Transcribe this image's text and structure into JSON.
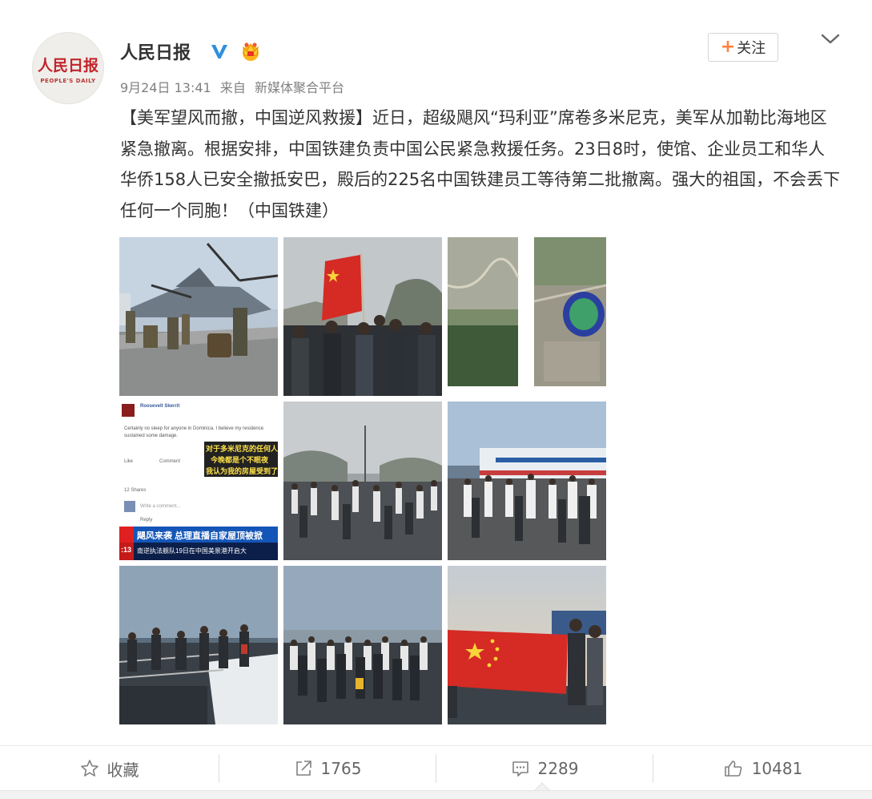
{
  "post": {
    "avatar_logo_cn": "人民日报",
    "avatar_logo_en": "PEOPLE'S DAILY",
    "username": "人民日报",
    "date": "9月24日 13:41",
    "source_prefix": "来自",
    "source": "新媒体聚合平台",
    "follow_label": "关注",
    "follow_plus": "+",
    "text": "【美军望风而撤，中国逆风救援】近日，超级飓风“玛利亚”席卷多米尼克，美军从加勒比海地区紧急撤离。根据安排，中国铁建负责中国公民紧急救援任务。23日8时，使馆、企业员工和华人华侨158人已安全撤抵安巴，殿后的225名中国铁建员工等待第二批撤离。强大的祖国，不会丢下任何一个同胞！（中国铁建）",
    "icons": {
      "verified": "verified-v-icon",
      "crown": "member-crown-icon",
      "chevron": "chevron-down-icon"
    },
    "colors": {
      "accent_orange": "#ff8140",
      "verified_blue": "#2d8fe0",
      "flag_red": "#d62a24",
      "flag_star": "#f8d33a"
    }
  },
  "photos": [
    {
      "id": "photo-1",
      "alt": "military aircraft on deck"
    },
    {
      "id": "photo-2",
      "alt": "group holding Chinese flag"
    },
    {
      "id": "photo-3",
      "alt": "satellite map images"
    },
    {
      "id": "photo-4",
      "alt": "social media screenshot",
      "profile_name": "Roosevelt Skerrit",
      "post_excerpt": "Certainly no sleep for anyone in Dominica. I believe my residence sustained some damage.",
      "cn_caption_1": "对于多米尼克的任何人来说",
      "cn_caption_2": "今晚都是个不眠夜",
      "cn_caption_3": "我认为我的房屋受到了损",
      "like": "Like",
      "comment": "Comment",
      "shares": "12 Shares",
      "write_comment": "Write a comment...",
      "reply": "Reply",
      "ticker_time": ":13",
      "ticker_headline": "飓风来袭 总理直播自家屋顶被掀",
      "ticker_sub": "南逆执法舰队19日在中国美景港开启大"
    },
    {
      "id": "photo-5",
      "alt": "crowd at port"
    },
    {
      "id": "photo-6",
      "alt": "people boarding ferry"
    },
    {
      "id": "photo-7",
      "alt": "people on boat deck"
    },
    {
      "id": "photo-8",
      "alt": "crowd waiting at dock"
    },
    {
      "id": "photo-9",
      "alt": "people holding Chinese flag at dusk"
    }
  ],
  "actions": [
    {
      "name": "favorite",
      "label": "收藏",
      "icon": "star-outline-icon"
    },
    {
      "name": "repost",
      "label": "1765",
      "icon": "share-box-icon"
    },
    {
      "name": "comment",
      "label": "2289",
      "icon": "comment-bubble-icon"
    },
    {
      "name": "like",
      "label": "10481",
      "icon": "thumb-up-icon"
    }
  ]
}
